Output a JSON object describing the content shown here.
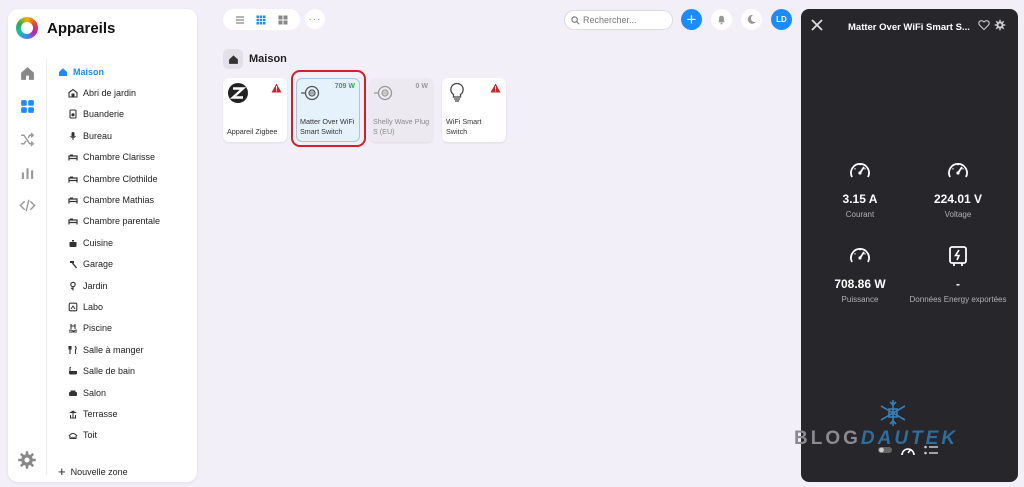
{
  "app": {
    "title": "Appareils"
  },
  "sidebar": {
    "zones": [
      {
        "label": "Maison",
        "icon": "home-icon"
      },
      {
        "label": "Abri de jardin",
        "icon": "shed-icon"
      },
      {
        "label": "Buanderie",
        "icon": "washer-icon"
      },
      {
        "label": "Bureau",
        "icon": "microphone-icon"
      },
      {
        "label": "Chambre Clarisse",
        "icon": "bed-icon"
      },
      {
        "label": "Chambre Clothilde",
        "icon": "bed-icon"
      },
      {
        "label": "Chambre Mathias",
        "icon": "bed-icon"
      },
      {
        "label": "Chambre parentale",
        "icon": "bed-icon"
      },
      {
        "label": "Cuisine",
        "icon": "pot-icon"
      },
      {
        "label": "Garage",
        "icon": "hammer-icon"
      },
      {
        "label": "Jardin",
        "icon": "flower-icon"
      },
      {
        "label": "Labo",
        "icon": "lab-icon"
      },
      {
        "label": "Piscine",
        "icon": "pool-icon"
      },
      {
        "label": "Salle à manger",
        "icon": "cutlery-icon"
      },
      {
        "label": "Salle de bain",
        "icon": "bathtub-icon"
      },
      {
        "label": "Salon",
        "icon": "sofa-icon"
      },
      {
        "label": "Terrasse",
        "icon": "terrace-icon"
      },
      {
        "label": "Toit",
        "icon": "roof-icon"
      }
    ],
    "add_zone_label": "Nouvelle zone"
  },
  "toolbar": {
    "search_placeholder": "Rechercher...",
    "avatar_initials": "LD"
  },
  "section": {
    "title": "Maison"
  },
  "devices": [
    {
      "name": "Appareil Zigbee",
      "icon": "zigbee-icon",
      "warning": true,
      "power": ""
    },
    {
      "name": "Matter Over WiFi Smart Switch",
      "icon": "plug-icon",
      "warning": false,
      "power": "709 W"
    },
    {
      "name": "Shelly Wave Plug S (EU)",
      "icon": "plug-icon",
      "warning": false,
      "power": "0 W"
    },
    {
      "name": "WiFi Smart Switch",
      "icon": "bulb-icon",
      "warning": true,
      "power": ""
    }
  ],
  "panel": {
    "title": "Matter Over WiFi Smart S...",
    "metrics": [
      {
        "value": "3.15 A",
        "label": "Courant",
        "icon": "gauge-icon"
      },
      {
        "value": "224.01 V",
        "label": "Voltage",
        "icon": "gauge-icon"
      },
      {
        "value": "708.86 W",
        "label": "Puissance",
        "icon": "gauge-icon"
      },
      {
        "value": "-",
        "label": "Données Energy exportées",
        "icon": "meter-icon"
      }
    ],
    "watermark_a": "BLOG",
    "watermark_b": "DAUTEK"
  },
  "colors": {
    "accent": "#1a8cff",
    "warning": "#d0202a",
    "power_on": "#2fa84f",
    "panel_bg": "#27262b"
  }
}
